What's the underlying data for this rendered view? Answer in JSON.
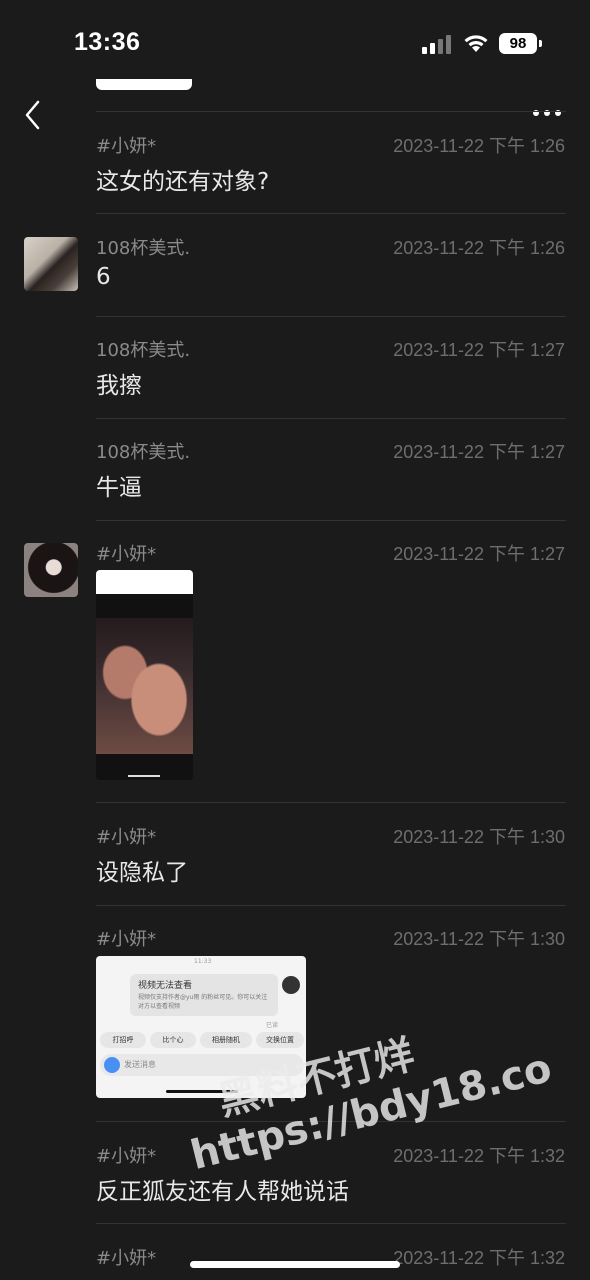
{
  "status_bar": {
    "time": "13:36",
    "battery": "98"
  },
  "messages": [
    {
      "name": "#小妍*",
      "time": "2023-11-22 下午 1:26",
      "text": "这女的还有对象?"
    },
    {
      "name": "108杯美式.",
      "time": "2023-11-22 下午 1:26",
      "text": "6"
    },
    {
      "name": "108杯美式.",
      "time": "2023-11-22 下午 1:27",
      "text": "我擦"
    },
    {
      "name": "108杯美式.",
      "time": "2023-11-22 下午 1:27",
      "text": "牛逼"
    },
    {
      "name": "#小妍*",
      "time": "2023-11-22 下午 1:27"
    },
    {
      "name": "#小妍*",
      "time": "2023-11-22 下午 1:30",
      "text": "设隐私了"
    },
    {
      "name": "#小妍*",
      "time": "2023-11-22 下午 1:30"
    },
    {
      "name": "#小妍*",
      "time": "2023-11-22 下午 1:32",
      "text": "反正狐友还有人帮她说话"
    },
    {
      "name": "#小妍*",
      "time": "2023-11-22 下午 1:32"
    }
  ],
  "screenshot_image": {
    "time": "11:33",
    "title": "视频无法查看",
    "body": "视频仅支持作者@yu雨 的粉丝可见。你可以关注对方以查看视频",
    "read": "已读",
    "chips": [
      "打招呼",
      "比个心",
      "相册随机",
      "交换位置"
    ],
    "input_placeholder": "发送消息"
  },
  "watermark": {
    "line1": "黑料不打烊",
    "line2": "https://bdy18.co"
  }
}
